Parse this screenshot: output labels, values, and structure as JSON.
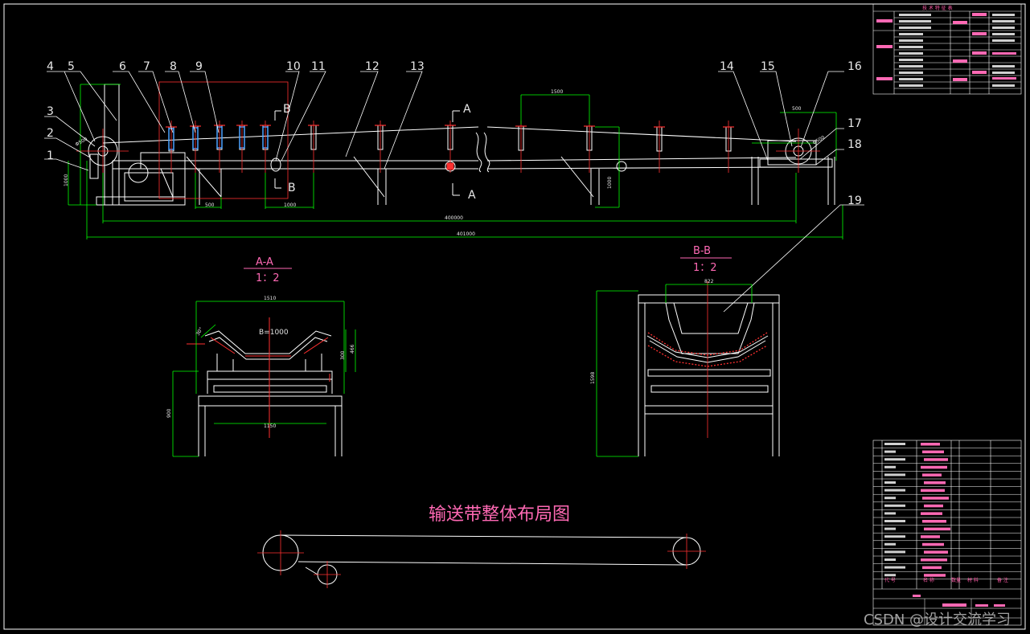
{
  "title": "输送带整体布局图",
  "watermark": "CSDN @设计交流学习",
  "callouts": [
    "1",
    "2",
    "3",
    "4",
    "5",
    "6",
    "7",
    "8",
    "9",
    "10",
    "11",
    "12",
    "13",
    "14",
    "15",
    "16",
    "17",
    "18",
    "19"
  ],
  "section_labels": {
    "aa": "A-A",
    "aa_scale": "1：2",
    "bb": "B-B",
    "bb_scale": "1：2",
    "a_mark": "A",
    "b_mark": "B",
    "belt_width": "B=1000"
  },
  "dimensions": {
    "span1": "1500",
    "span2": "500",
    "span3": "1000",
    "overall": "400000",
    "overall2": "401000",
    "roller_base": "500",
    "aa_width": "1510",
    "aa_inner": "1150",
    "aa_height": "900",
    "aa_h2": "300",
    "aa_h3": "466",
    "bb_width": "822",
    "bb_height": "1598",
    "left_d": "Φ500",
    "right_d": "Φ500",
    "left_h": "1000",
    "right_h": "1000",
    "angle": "30°"
  },
  "tech_table": {
    "header": "技 术 特 征 表"
  },
  "parts_table": {
    "footer_labels": [
      "代 号",
      "名 称",
      "数量",
      "材 料",
      "备 注"
    ]
  },
  "colors": {
    "background": "#000000",
    "line": "#ffffff",
    "dim": "#00ff00",
    "center": "#ff3030",
    "accent": "#ff69b4",
    "roller": "#4aa3ff"
  }
}
